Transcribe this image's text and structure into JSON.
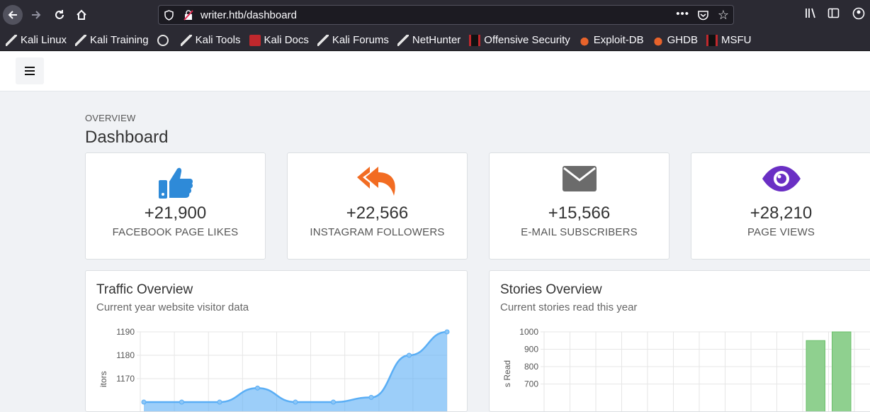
{
  "browser": {
    "url": "writer.htb/dashboard",
    "url_dots": "•••"
  },
  "bookmarks": [
    {
      "label": "Kali Linux",
      "icon": "kali-dragon-icon"
    },
    {
      "label": "Kali Training",
      "icon": "kali-dragon-icon"
    },
    {
      "label": "",
      "icon": "globe-icon"
    },
    {
      "label": "Kali Tools",
      "icon": "kali-dragon-icon"
    },
    {
      "label": "Kali Docs",
      "icon": "kali-docs-icon"
    },
    {
      "label": "Kali Forums",
      "icon": "kali-dragon-icon"
    },
    {
      "label": "NetHunter",
      "icon": "kali-dragon-icon"
    },
    {
      "label": "Offensive Security",
      "icon": "offsec-icon"
    },
    {
      "label": "Exploit-DB",
      "icon": "exploit-db-icon"
    },
    {
      "label": "GHDB",
      "icon": "exploit-db-icon"
    },
    {
      "label": "MSFU",
      "icon": "offsec-icon"
    }
  ],
  "page": {
    "overview_label": "OVERVIEW",
    "title": "Dashboard"
  },
  "stats": [
    {
      "value": "+21,900",
      "label": "FACEBOOK PAGE LIKES",
      "icon": "thumbs-up-icon",
      "color": "#2e8ad8"
    },
    {
      "value": "+22,566",
      "label": "INSTAGRAM FOLLOWERS",
      "icon": "reply-all-icon",
      "color": "#f26c22"
    },
    {
      "value": "+15,566",
      "label": "E-MAIL SUBSCRIBERS",
      "icon": "envelope-icon",
      "color": "#6b6b6b"
    },
    {
      "value": "+28,210",
      "label": "PAGE VIEWS",
      "icon": "eye-icon",
      "color": "#6a2fc4"
    }
  ],
  "traffic": {
    "title": "Traffic Overview",
    "subtitle": "Current year website visitor data",
    "ylabel_fragment": "itors",
    "y_ticks": [
      "1190",
      "1180",
      "1170"
    ]
  },
  "stories": {
    "title": "Stories Overview",
    "subtitle": "Current stories read this year",
    "ylabel_fragment": "s Read",
    "y_ticks": [
      "1000",
      "900",
      "800",
      "700"
    ]
  },
  "chart_data": [
    {
      "type": "area",
      "title": "Traffic Overview",
      "subtitle": "Current year website visitor data",
      "ylim": [
        1160,
        1190
      ],
      "grid": true,
      "series": [
        {
          "values": [
            1160,
            1160,
            1160,
            1166,
            1160,
            1160,
            1162,
            1180,
            1190
          ]
        }
      ],
      "color": "#5aaef5"
    },
    {
      "type": "bar",
      "title": "Stories Overview",
      "subtitle": "Current stories read this year",
      "ylim": [
        700,
        1000
      ],
      "grid": true,
      "values": [
        0,
        0,
        0,
        0,
        0,
        0,
        0,
        0,
        0,
        0,
        950,
        1000
      ],
      "color": "#8fd08f"
    }
  ]
}
